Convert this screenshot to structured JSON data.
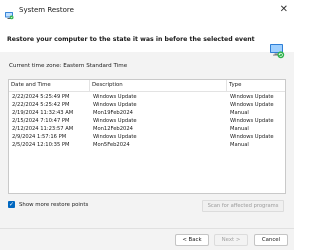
{
  "window": {
    "title": "System Restore",
    "close_glyph": "✕"
  },
  "header": {
    "headline": "Restore your computer to the state it was in before the selected event"
  },
  "timezone": "Current time zone: Eastern Standard Time",
  "table": {
    "columns": {
      "date": "Date and Time",
      "description": "Description",
      "type": "Type"
    },
    "rows": [
      {
        "date": "2/22/2024 5:25:49 PM",
        "description": "Windows Update",
        "type": "Windows Update"
      },
      {
        "date": "2/22/2024 5:25:42 PM",
        "description": "Windows Update",
        "type": "Windows Update"
      },
      {
        "date": "2/19/2024 11:32:43 AM",
        "description": "Mon19Feb2024",
        "type": "Manual"
      },
      {
        "date": "2/15/2024 7:10:47 PM",
        "description": "Windows Update",
        "type": "Windows Update"
      },
      {
        "date": "2/12/2024 11:23:57 AM",
        "description": "Mon12Feb2024",
        "type": "Manual"
      },
      {
        "date": "2/9/2024 1:57:16 PM",
        "description": "Windows Update",
        "type": "Windows Update"
      },
      {
        "date": "2/5/2024 12:10:35 PM",
        "description": "Mon5Feb2024",
        "type": "Manual"
      }
    ]
  },
  "show_more": {
    "label": "Show more restore points",
    "checked": true
  },
  "scan_button": "Scan for affected programs",
  "footer": {
    "back": "< Back",
    "next": "Next >",
    "cancel": "Cancel"
  },
  "colors": {
    "accent": "#0067c0",
    "window_bg": "#f3f3f3",
    "disabled_text": "#a0a0a0"
  },
  "icons": {
    "app": "system-restore-icon",
    "hero": "restore-monitor-icon"
  }
}
